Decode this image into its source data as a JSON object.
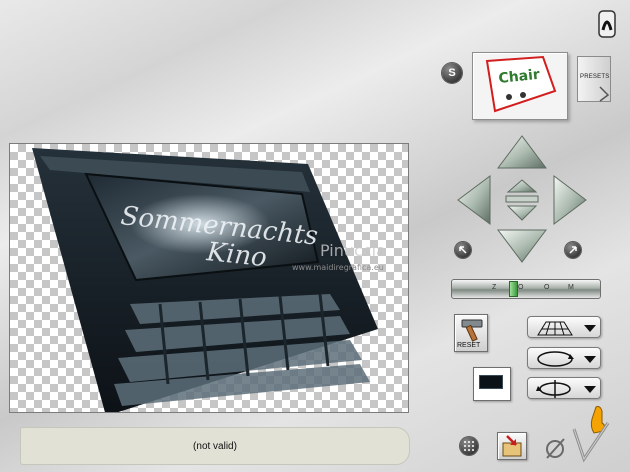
{
  "status": {
    "text": "(not valid)"
  },
  "thumbnail": {
    "preset_name": "Chair"
  },
  "presets_button": {
    "label": "PRESETS"
  },
  "s_button": {
    "label": "S"
  },
  "zoom": {
    "ticks": [
      "Z",
      "O",
      "O",
      "M"
    ],
    "value_fraction": 0.41
  },
  "reset_button": {
    "label": "RESET"
  },
  "preview": {
    "title_line1": "Sommernachts",
    "title_line2": "Kino",
    "watermark_name": "Pinuccia",
    "watermark_url": "www.maidiregrafica.eu"
  },
  "colors": {
    "accent_green": "#3a9a3a",
    "status_bg": "#e1e1d6",
    "pointer_orange": "#f5a300"
  }
}
